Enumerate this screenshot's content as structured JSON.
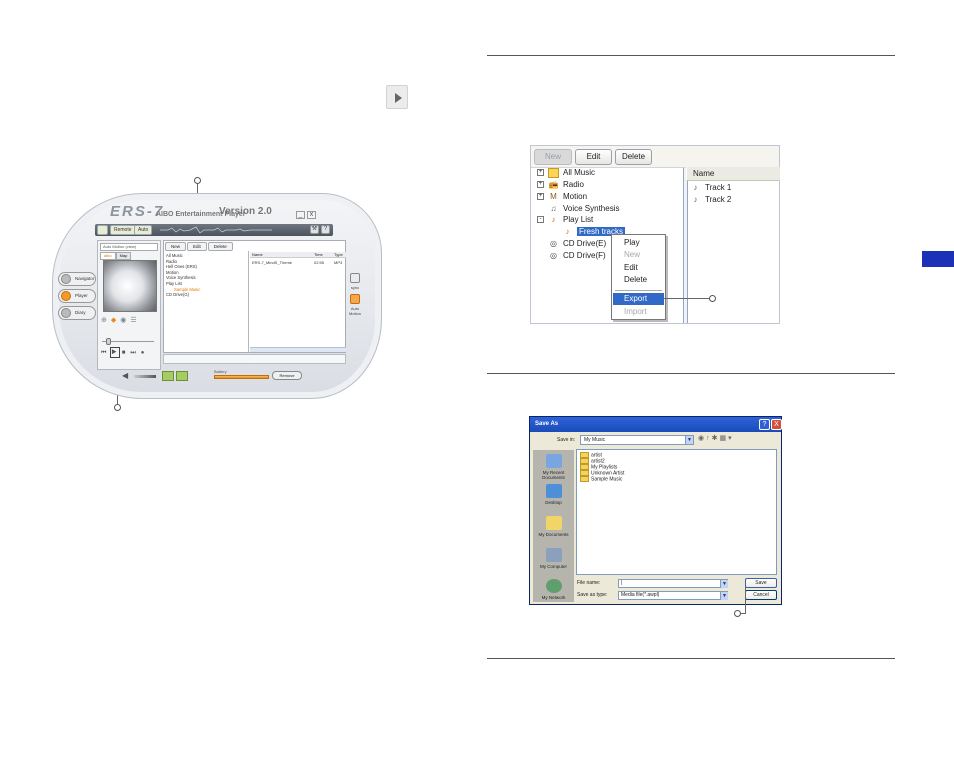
{
  "left_page": {
    "player": {
      "logo": "ERS-7",
      "subtitle": "AIBO Entertainment Player",
      "version": "Version 2.0",
      "window_min": "_",
      "window_close": "x",
      "top_tabs": [
        "",
        "Remote",
        "Auto"
      ],
      "tool_icons": [
        "wrench-icon",
        "help-icon"
      ],
      "side_buttons": [
        "Navigator",
        "Player",
        "Diary"
      ],
      "combo_text": "Auto Motion (view)",
      "mini_tabs": [
        "aibo",
        "Map"
      ],
      "main_tabs": [
        "New",
        "Edit",
        "Delete"
      ],
      "tree_items": [
        "All Music",
        "Radio",
        "Hell Ones (ERS)",
        "Motion",
        "Voice Synthesis",
        "Play List",
        "Sample Music",
        "CD Drive(G)"
      ],
      "list_columns": [
        "Name",
        "Time",
        "Type"
      ],
      "list_rows": [
        {
          "name": "ERS-7_MindS_Theme",
          "time": "02:55",
          "type": "MP3"
        }
      ],
      "right_tools": [
        "sync",
        "Auto Motion"
      ],
      "battery_label": "Battery",
      "remove_label": "Remove"
    }
  },
  "right_page": {
    "tree_window": {
      "toolbar": [
        "New",
        "Edit",
        "Delete"
      ],
      "tree": [
        {
          "expander": "+",
          "icon": "folder",
          "label": "All Music"
        },
        {
          "expander": "+",
          "icon": "radio",
          "label": "Radio"
        },
        {
          "expander": "+",
          "icon": "motion",
          "label": "Motion"
        },
        {
          "expander": "",
          "icon": "voice",
          "label": "Voice Synthesis"
        },
        {
          "expander": "-",
          "icon": "playlist",
          "label": "Play List"
        },
        {
          "expander": "",
          "icon": "playlist",
          "label": "Fresh tracks"
        },
        {
          "expander": "",
          "icon": "cd",
          "label": "CD Drive(E)"
        },
        {
          "expander": "",
          "icon": "cd",
          "label": "CD Drive(F)"
        }
      ],
      "column_header": "Name",
      "tracks": [
        "Track 1",
        "Track 2"
      ],
      "context_menu": [
        {
          "label": "Play",
          "state": "normal"
        },
        {
          "label": "New",
          "state": "disabled"
        },
        {
          "label": "Edit",
          "state": "normal"
        },
        {
          "label": "Delete",
          "state": "normal"
        },
        {
          "label": "Export",
          "state": "active"
        },
        {
          "label": "Import",
          "state": "disabled"
        }
      ]
    },
    "save_dialog": {
      "title": "Save As",
      "help_btn": "?",
      "close_btn": "X",
      "save_in_label": "Save in:",
      "save_in_value": "My Music",
      "places": [
        "My Recent Documents",
        "Desktop",
        "My Documents",
        "My Computer",
        "My Network"
      ],
      "files": [
        "artist",
        "artist2",
        "My Playlists",
        "Unknown Artist",
        "Sample Music"
      ],
      "file_name_label": "File name:",
      "file_name_value": "|",
      "save_type_label": "Save as type:",
      "save_type_value": "Media file(*.awpl)",
      "save_button": "Save",
      "cancel_button": "Cancel"
    },
    "colors": {
      "accent_tab": "#1c30b8",
      "selection": "#3169c6"
    }
  }
}
